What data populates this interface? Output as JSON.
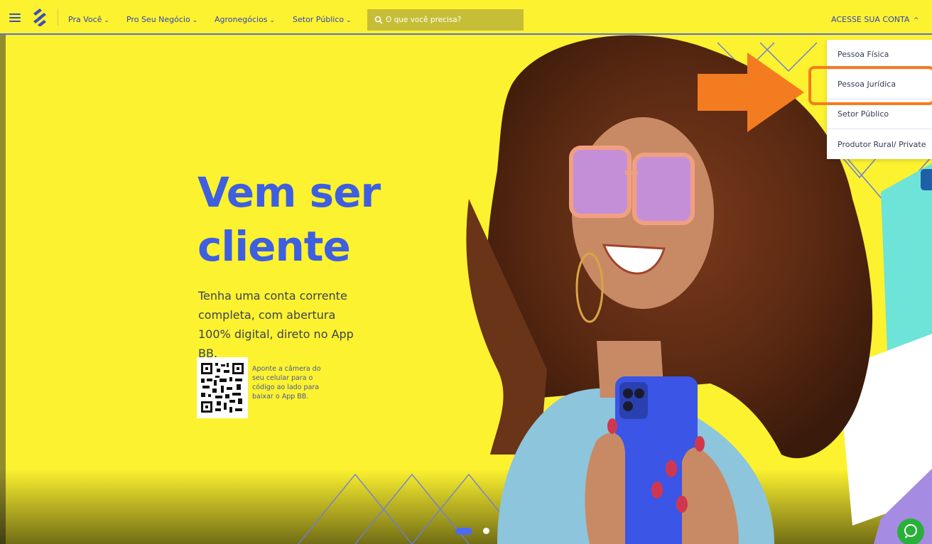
{
  "nav": {
    "items": [
      {
        "label": "Pra Você"
      },
      {
        "label": "Pro Seu Negócio"
      },
      {
        "label": "Agronegócios"
      },
      {
        "label": "Setor Público"
      }
    ],
    "chevron": "⌄",
    "search_placeholder": "O que você precisa?",
    "account_label": "ACESSE SUA CONTA",
    "account_chevron": "^"
  },
  "dropdown": {
    "items": [
      {
        "label": "Pessoa Física"
      },
      {
        "label": "Pessoa Jurídica"
      },
      {
        "label": "Setor Público"
      },
      {
        "label": "Produtor Rural/ Private"
      }
    ],
    "highlighted_index": 1
  },
  "hero": {
    "title_line1": "Vem ser",
    "title_line2": "cliente",
    "subtitle": "Tenha uma conta corrente completa, com abertura 100% digital, direto no App BB.",
    "qr_caption": "Aponte a câmera do seu celular para o código ao lado para baixar o App BB."
  },
  "carousel": {
    "slides": 2,
    "active_index": 0
  },
  "icons": {
    "menu": "hamburger-icon",
    "logo": "bb-logo",
    "search": "search-icon",
    "whatsapp": "whatsapp-icon",
    "annotation": "orange-arrow"
  },
  "colors": {
    "background": "#fdf22f",
    "brand_blue": "#3e5fe0",
    "annotation_orange": "#f47c20",
    "search_bg": "#c6be36"
  }
}
